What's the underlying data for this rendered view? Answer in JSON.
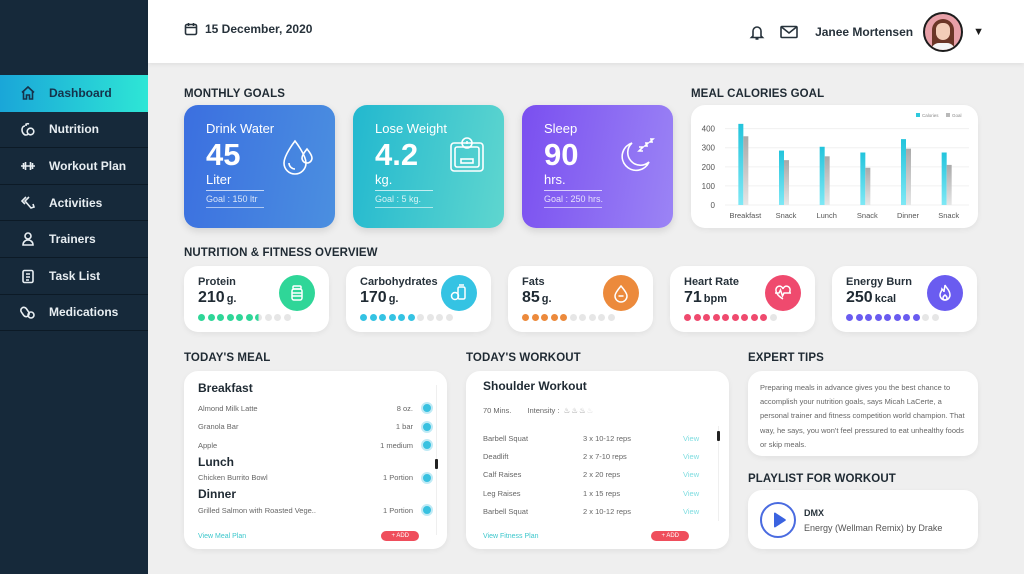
{
  "sidebar": {
    "items": [
      {
        "label": "Dashboard",
        "icon": "home-icon",
        "active": true
      },
      {
        "label": "Nutrition",
        "icon": "apple-icon",
        "active": false
      },
      {
        "label": "Workout Plan",
        "icon": "dumbbell-icon",
        "active": false
      },
      {
        "label": "Activities",
        "icon": "sneaker-icon",
        "active": false
      },
      {
        "label": "Trainers",
        "icon": "person-icon",
        "active": false
      },
      {
        "label": "Task List",
        "icon": "clipboard-icon",
        "active": false
      },
      {
        "label": "Medications",
        "icon": "pills-icon",
        "active": false
      }
    ]
  },
  "header": {
    "date": "15 December, 2020",
    "user_name": "Janee Mortensen"
  },
  "monthly_goals": {
    "title": "MONTHLY GOALS",
    "cards": [
      {
        "title": "Drink Water",
        "value": "45",
        "unit": "Liter",
        "goal": "Goal : 150 ltr",
        "icon": "water-drop-icon",
        "gradient": [
          "#3b6fe0",
          "#4b8fe0"
        ]
      },
      {
        "title": "Lose Weight",
        "value": "4.2",
        "unit": "kg.",
        "goal": "Goal : 5 kg.",
        "icon": "scale-icon",
        "gradient": [
          "#22b8cf",
          "#5fd6cf"
        ]
      },
      {
        "title": "Sleep",
        "value": "90",
        "unit": "hrs.",
        "goal": "Goal : 250 hrs.",
        "icon": "moon-sleep-icon",
        "gradient": [
          "#7a4ff0",
          "#9b84f5"
        ]
      }
    ]
  },
  "chart_data": {
    "type": "bar",
    "title": "MEAL CALORIES GOAL",
    "categories": [
      "Breakfast",
      "Snack",
      "Lunch",
      "Snack",
      "Dinner",
      "Snack"
    ],
    "series": [
      {
        "name": "Calories",
        "values": [
          425,
          285,
          305,
          275,
          345,
          275
        ],
        "color": "#2ec9dd"
      },
      {
        "name": "Goal",
        "values": [
          360,
          235,
          255,
          195,
          295,
          210
        ],
        "color": "#b9b9b9"
      }
    ],
    "yticks": [
      0,
      100,
      200,
      300,
      400
    ],
    "ylim": [
      0,
      440
    ],
    "grid": true,
    "legend": "top-right",
    "xlabel": "",
    "ylabel": ""
  },
  "overview": {
    "title": "NUTRITION & FITNESS OVERVIEW",
    "stats": [
      {
        "label": "Protein",
        "value": "210",
        "unit": "g.",
        "filled": 6.5,
        "total": 10,
        "color": "#2fd698",
        "icon": "protein-jar-icon"
      },
      {
        "label": "Carbohydrates",
        "value": "170",
        "unit": "g.",
        "filled": 6,
        "total": 10,
        "color": "#35c3e3",
        "icon": "carbs-icon"
      },
      {
        "label": "Fats",
        "value": "85",
        "unit": "g.",
        "filled": 5,
        "total": 10,
        "color": "#ec8a3c",
        "icon": "fat-drop-icon"
      },
      {
        "label": "Heart Rate",
        "value": "71",
        "unit": "bpm",
        "filled": 9,
        "total": 10,
        "color": "#ef4a6e",
        "icon": "heart-pulse-icon"
      },
      {
        "label": "Energy Burn",
        "value": "250",
        "unit": "kcal",
        "filled": 8,
        "total": 10,
        "color": "#6a5cf0",
        "icon": "flame-icon"
      }
    ]
  },
  "meal": {
    "title": "TODAY'S MEAL",
    "groups": [
      {
        "name": "Breakfast",
        "items": [
          {
            "name": "Almond Milk Latte",
            "qty": "8 oz."
          },
          {
            "name": "Granola Bar",
            "qty": "1 bar"
          },
          {
            "name": "Apple",
            "qty": "1 medium"
          }
        ]
      },
      {
        "name": "Lunch",
        "items": [
          {
            "name": "Chicken Burrito Bowl",
            "qty": "1 Portion"
          }
        ]
      },
      {
        "name": "Dinner",
        "items": [
          {
            "name": "Grilled Salmon with Roasted Vege..",
            "qty": "1 Portion"
          }
        ]
      }
    ],
    "link": "View Meal Plan",
    "add": "+ ADD"
  },
  "workout": {
    "title": "TODAY'S WORKOUT",
    "name": "Shoulder Workout",
    "duration": "70 Mins.",
    "intensity_label": "Intensity :",
    "intensity": 3,
    "intensity_max": 4,
    "rows": [
      {
        "name": "Barbell Squat",
        "reps": "3 x 10-12 reps",
        "action": "View"
      },
      {
        "name": "Deadlift",
        "reps": "2 x  7-10 reps",
        "action": "View"
      },
      {
        "name": "Calf Raises",
        "reps": "2 x  20 reps",
        "action": "View"
      },
      {
        "name": "Leg Raises",
        "reps": "1 x  15 reps",
        "action": "View"
      },
      {
        "name": "Barbell Squat",
        "reps": "2 x 10-12 reps",
        "action": "View"
      }
    ],
    "link": "View Fitness Plan",
    "add": "+ ADD"
  },
  "tips": {
    "title": "EXPERT TIPS",
    "text": "Preparing meals in advance gives you the best chance to accomplish your nutrition goals, says Micah LaCerte, a personal trainer and fitness competition world champion. That way, he says, you won't feel pressured to eat unhealthy foods or skip meals."
  },
  "playlist": {
    "title": "PLAYLIST FOR WORKOUT",
    "artist": "DMX",
    "track": "Energy (Wellman Remix) by Drake"
  }
}
